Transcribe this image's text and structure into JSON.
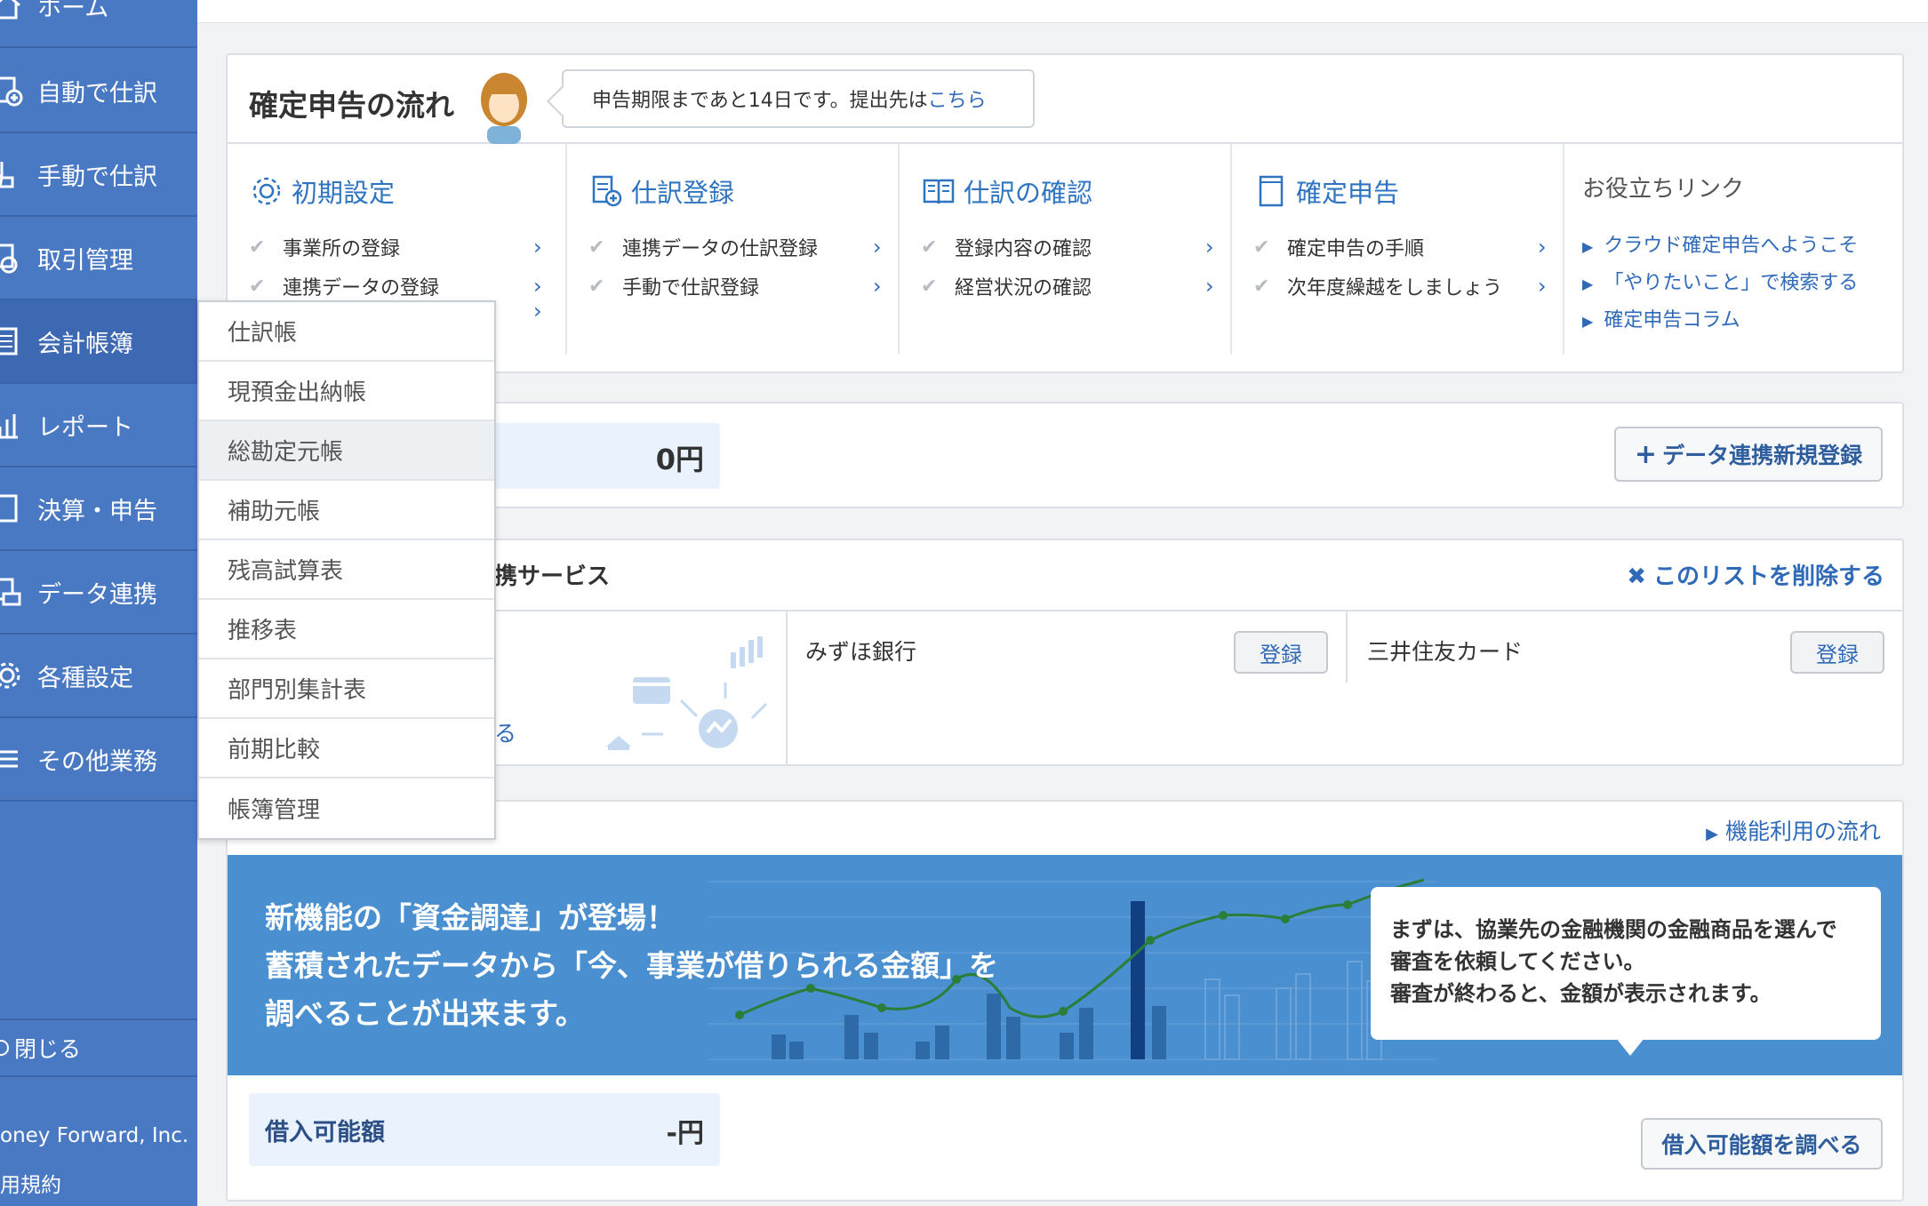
{
  "sidebar": {
    "items": [
      {
        "label": "ホーム",
        "icon": "home-icon"
      },
      {
        "label": "自動で仕訳",
        "icon": "auto-entry-icon"
      },
      {
        "label": "手動で仕訳",
        "icon": "manual-entry-icon"
      },
      {
        "label": "取引管理",
        "icon": "transaction-icon"
      },
      {
        "label": "会計帳簿",
        "icon": "ledger-icon"
      },
      {
        "label": "レポート",
        "icon": "report-icon"
      },
      {
        "label": "決算・申告",
        "icon": "closing-icon"
      },
      {
        "label": "データ連携",
        "icon": "data-link-icon"
      },
      {
        "label": "各種設定",
        "icon": "gear-icon"
      },
      {
        "label": "その他業務",
        "icon": "menu-icon"
      }
    ],
    "close_label": "閉じる",
    "footer_company": "oney Forward, Inc.",
    "footer_terms": "用規約"
  },
  "flow": {
    "title": "確定申告の流れ",
    "deadline_text": "申告期限まであと14日です。提出先は",
    "deadline_link": "こちら",
    "columns": [
      {
        "heading": "初期設定",
        "tasks": [
          "事業所の登録",
          "連携データの登録"
        ]
      },
      {
        "heading": "仕訳登録",
        "tasks": [
          "連携データの仕訳登録",
          "手動で仕訳登録"
        ]
      },
      {
        "heading": "仕訳の確認",
        "tasks": [
          "登録内容の確認",
          "経営状況の確認"
        ]
      },
      {
        "heading": "確定申告",
        "tasks": [
          "確定申告の手順",
          "次年度繰越をしましょう"
        ]
      }
    ],
    "links_heading": "お役立ちリンク",
    "links": [
      "クラウド確定申告へようこそ",
      "「やりたいこと」で検索する",
      "確定申告コラム"
    ]
  },
  "balance": {
    "value": "0円",
    "register_button": "データ連携新規登録"
  },
  "services": {
    "title": "携サービス",
    "delete_label": "このリストを削除する",
    "partial_text": "る",
    "items": [
      {
        "name": "みずほ銀行",
        "button": "登録"
      },
      {
        "name": "三井住友カード",
        "button": "登録"
      }
    ]
  },
  "funding": {
    "flow_link": "機能利用の流れ",
    "banner_lines": [
      "新機能の「資金調達」が登場！",
      "蓄積されたデータから「今、事業が借りられる金額」を",
      "調べることが出来ます。"
    ],
    "tooltip_lines": [
      "まずは、協業先の金融機関の金融商品を選んで",
      "審査を依頼してください。",
      "審査が終わると、金額が表示されます。"
    ],
    "loan_label": "借入可能額",
    "loan_value": "-円",
    "check_button": "借入可能額を調べる"
  },
  "dropdown": {
    "items": [
      "仕訳帳",
      "現預金出納帳",
      "総勘定元帳",
      "補助元帳",
      "残高試算表",
      "推移表",
      "部門別集計表",
      "前期比較",
      "帳簿管理"
    ],
    "hover_index": 2
  },
  "colors": {
    "sidebar": "#4a79c4",
    "accent": "#2f74c0",
    "banner": "#4a8fd0"
  }
}
